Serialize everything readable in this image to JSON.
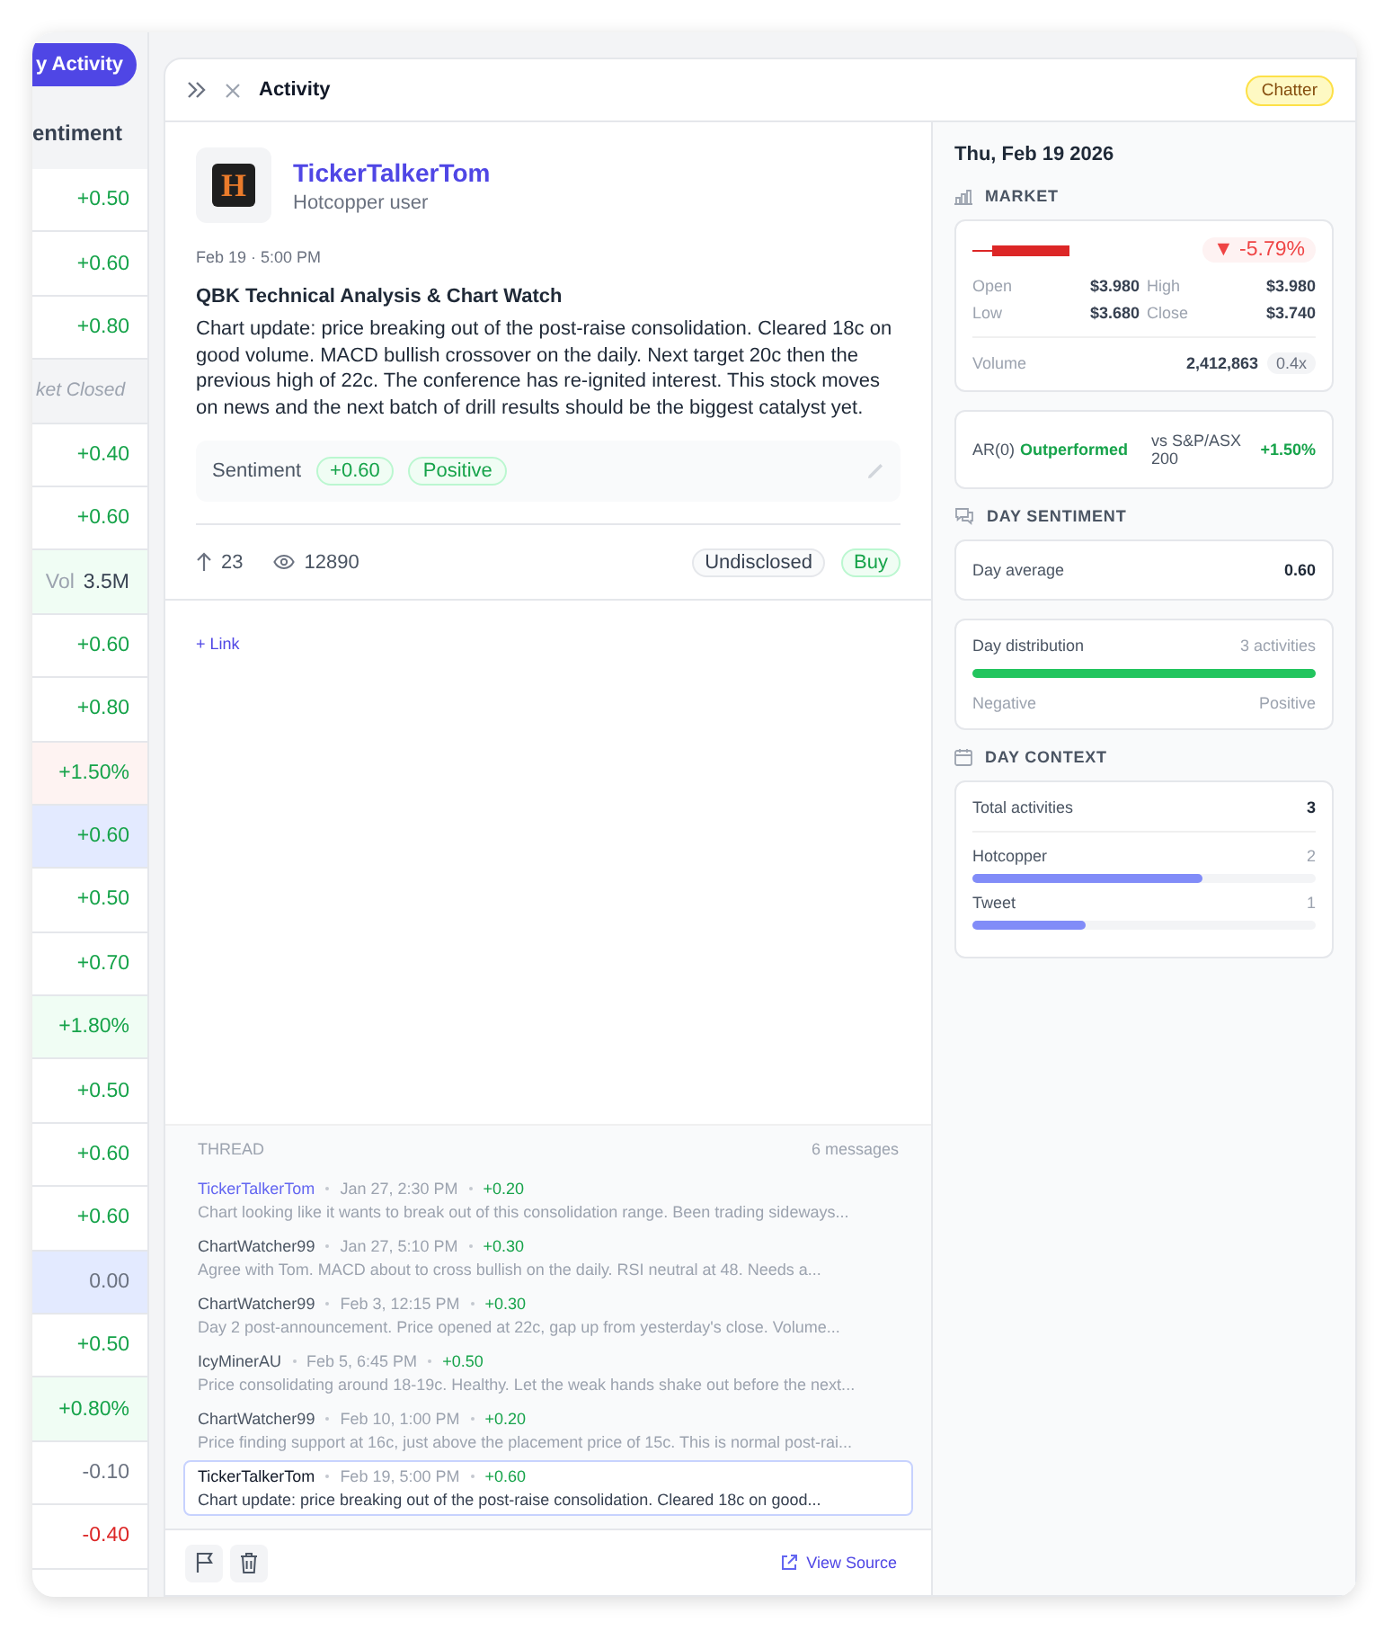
{
  "left_list": {
    "button": "y Activity",
    "header": "entiment",
    "rows": [
      {
        "kind": "score",
        "text": "+0.50",
        "color": "#16a34a",
        "selected": false
      },
      {
        "kind": "score",
        "text": "+0.60",
        "color": "#16a34a",
        "selected": false
      },
      {
        "kind": "score",
        "text": "+0.80",
        "color": "#16a34a",
        "selected": false
      },
      {
        "kind": "closed",
        "text": "ket Closed",
        "color": "#9ca3af",
        "selected": false
      },
      {
        "kind": "score",
        "text": "+0.40",
        "color": "#16a34a",
        "selected": false
      },
      {
        "kind": "score",
        "text": "+0.60",
        "color": "#16a34a",
        "selected": false
      },
      {
        "kind": "volume",
        "label": "Vol",
        "text": "3.5M",
        "color": "#374151",
        "selected": false
      },
      {
        "kind": "score",
        "text": "+0.60",
        "color": "#16a34a",
        "selected": false
      },
      {
        "kind": "score",
        "text": "+0.80",
        "color": "#16a34a",
        "selected": false
      },
      {
        "kind": "change",
        "text": "+1.50%",
        "color": "#16a34a",
        "warning": true,
        "selected": false
      },
      {
        "kind": "score",
        "text": "+0.60",
        "color": "#16a34a",
        "selected": true
      },
      {
        "kind": "score",
        "text": "+0.50",
        "color": "#16a34a",
        "selected": false
      },
      {
        "kind": "score",
        "text": "+0.70",
        "color": "#16a34a",
        "selected": false
      },
      {
        "kind": "change",
        "text": "+1.80%",
        "color": "#16a34a",
        "warning": false,
        "selected": false
      },
      {
        "kind": "score",
        "text": "+0.50",
        "color": "#16a34a",
        "selected": false
      },
      {
        "kind": "score",
        "text": "+0.60",
        "color": "#16a34a",
        "selected": false
      },
      {
        "kind": "score",
        "text": "+0.60",
        "color": "#16a34a",
        "selected": false
      },
      {
        "kind": "score",
        "text": "0.00",
        "color": "#6b7280",
        "selected": true
      },
      {
        "kind": "score",
        "text": "+0.50",
        "color": "#16a34a",
        "selected": false
      },
      {
        "kind": "change",
        "text": "+0.80%",
        "color": "#16a34a",
        "warning": false,
        "selected": false
      },
      {
        "kind": "score",
        "text": "-0.10",
        "color": "#6b7280",
        "selected": false
      },
      {
        "kind": "score",
        "text": "-0.40",
        "color": "#dc2626",
        "selected": false
      }
    ]
  },
  "panel": {
    "title": "Activity",
    "badge": "Chatter"
  },
  "post": {
    "author": "TickerTalkerTom",
    "author_role": "Hotcopper user",
    "source_letter": "H",
    "time": "Feb 19 · 5:00 PM",
    "title": "QBK Technical Analysis & Chart Watch",
    "body": "Chart update: price breaking out of the post-raise consolidation. Cleared 18c on good volume. MACD bullish crossover on the daily. Next target 20c then the previous high of 22c. The conference has re-ignited interest. This stock moves on news and the next batch of drill results should be the biggest catalyst yet.",
    "sentiment_label": "Sentiment",
    "sentiment_score": "+0.60",
    "sentiment_tag": "Positive",
    "upvotes": "23",
    "views": "12890",
    "tags": [
      "Undisclosed",
      "Buy"
    ],
    "link": "+ Link"
  },
  "thread": {
    "title": "THREAD",
    "count": "6 messages",
    "messages": [
      {
        "author": "TickerTalkerTom",
        "highlighted": true,
        "time": "Jan 27, 2:30 PM",
        "score": "+0.20",
        "text": "Chart looking like it wants to break out of this consolidation range. Been trading sideways...",
        "selected": false
      },
      {
        "author": "ChartWatcher99",
        "highlighted": false,
        "time": "Jan 27, 5:10 PM",
        "score": "+0.30",
        "text": "Agree with Tom. MACD about to cross bullish on the daily. RSI neutral at 48. Needs a...",
        "selected": false
      },
      {
        "author": "ChartWatcher99",
        "highlighted": false,
        "time": "Feb 3, 12:15 PM",
        "score": "+0.30",
        "text": "Day 2 post-announcement. Price opened at 22c, gap up from yesterday's close. Volume...",
        "selected": false
      },
      {
        "author": "IcyMinerAU",
        "highlighted": false,
        "time": "Feb 5, 6:45 PM",
        "score": "+0.50",
        "text": "Price consolidating around 18-19c. Healthy. Let the weak hands shake out before the next...",
        "selected": false
      },
      {
        "author": "ChartWatcher99",
        "highlighted": false,
        "time": "Feb 10, 1:00 PM",
        "score": "+0.20",
        "text": "Price finding support at 16c, just above the placement price of 15c. This is normal post-rai...",
        "selected": false
      },
      {
        "author": "TickerTalkerTom",
        "highlighted": false,
        "time": "Feb 19, 5:00 PM",
        "score": "+0.60",
        "text": "Chart update: price breaking out of the post-raise consolidation. Cleared 18c on good...",
        "selected": true
      }
    ]
  },
  "footer": {
    "view_source": "View Source"
  },
  "sidebar": {
    "date": "Thu, Feb 19 2026",
    "market_title": "MARKET",
    "change": "▼ -5.79%",
    "ohlc": [
      {
        "label": "Open",
        "value": "$3.980"
      },
      {
        "label": "High",
        "value": "$3.980"
      },
      {
        "label": "Low",
        "value": "$3.680"
      },
      {
        "label": "Close",
        "value": "$3.740"
      }
    ],
    "volume_label": "Volume",
    "volume": "2,412,863",
    "volume_ratio": "0.4x",
    "ar_label": "AR(0)",
    "ar_result": "Outperformed",
    "ar_benchmark": "vs S&P/ASX 200",
    "ar_value": "+1.50%",
    "sentiment_title": "DAY SENTIMENT",
    "day_average_label": "Day average",
    "day_average": "0.60",
    "distribution_label": "Day distribution",
    "distribution_count": "3 activities",
    "distribution_bar": {
      "level": 1.0
    },
    "negative_label": "Negative",
    "positive_label": "Positive",
    "context_title": "DAY CONTEXT",
    "total_label": "Total activities",
    "total": "3",
    "sources": [
      {
        "name": "Hotcopper",
        "count": "2",
        "level": 0.67
      },
      {
        "name": "Tweet",
        "count": "1",
        "level": 0.33
      }
    ]
  }
}
